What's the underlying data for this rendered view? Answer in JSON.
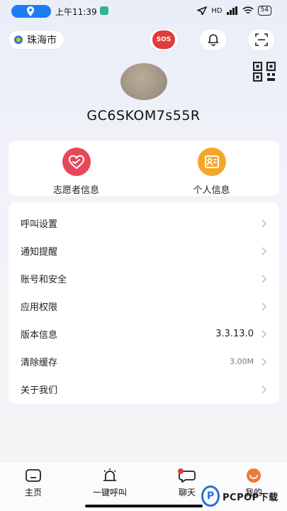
{
  "status_bar": {
    "time": "上午11:39",
    "signal": "HD",
    "battery": "54"
  },
  "header": {
    "city": "珠海市",
    "sos_label": "SOS"
  },
  "profile": {
    "username": "GC6SKOM7s55R"
  },
  "quick_actions": [
    {
      "label": "志愿者信息",
      "icon": "heart-hands-icon",
      "color": "#e8475a"
    },
    {
      "label": "个人信息",
      "icon": "id-card-icon",
      "color": "#f4a62a"
    }
  ],
  "settings": [
    {
      "label": "呼叫设置",
      "value": ""
    },
    {
      "label": "通知提醒",
      "value": ""
    },
    {
      "label": "账号和安全",
      "value": ""
    },
    {
      "label": "应用权限",
      "value": ""
    },
    {
      "label": "版本信息",
      "value": "3.3.13.0"
    },
    {
      "label": "清除缓存",
      "value": "3.00M"
    },
    {
      "label": "关于我们",
      "value": ""
    }
  ],
  "bottom_nav": [
    {
      "label": "主页",
      "icon": "home-icon"
    },
    {
      "label": "一键呼叫",
      "icon": "alarm-icon"
    },
    {
      "label": "聊天",
      "icon": "chat-icon"
    },
    {
      "label": "我的",
      "icon": "profile-icon"
    }
  ],
  "watermark": {
    "logo_letter": "P",
    "text": "PCPOP下载"
  },
  "colors": {
    "accent_red": "#e23b3b",
    "volunteer_red": "#e8475a",
    "personal_orange": "#f4a62a",
    "active_tab": "#f07a3a"
  }
}
